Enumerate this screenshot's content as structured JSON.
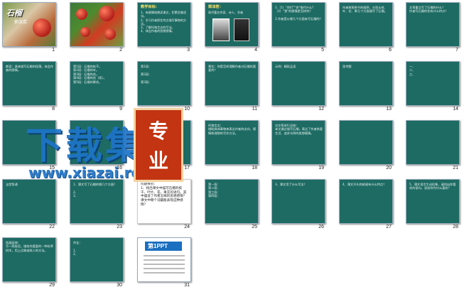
{
  "slides": [
    {
      "n": "1",
      "kind": "cover",
      "title": "石榴",
      "sub": "郭沫若"
    },
    {
      "n": "2",
      "kind": "photo"
    },
    {
      "n": "3",
      "title": "教学目标：",
      "body": "1、有感情地朗读课文，积累优美语句。\n2、学习作者抓住特点描写事物的方法。\n3、了解托物言志的写法。\n4、体会作者的思想感情。"
    },
    {
      "n": "4",
      "kind": "portrait",
      "title": "郭沫若：",
      "body": "现代著名作家、诗人、学者"
    },
    {
      "n": "5",
      "title": "",
      "body": "1.（1）\"你们\"\"你\"指代什么?\n（2）\"我\"的感情是怎样的？\n\n2.作者是从哪几个方面来写石榴的？"
    },
    {
      "n": "6",
      "title": "",
      "body": "作者按照季节的顺序，分别从枝、叶、花、果几个方面描写了石榴。"
    },
    {
      "n": "7",
      "title": "",
      "body": "文章重点写了石榴的什么？\n作者写石榴的花有什么特点？"
    },
    {
      "n": "8",
      "title": "",
      "body": "朗读：具体描写石榴的段落，体会作者的感情。"
    },
    {
      "n": "9",
      "title": "",
      "body": "第1段：石榴的枝干。\n第2段：石榴的叶。\n第3段：石榴的花。\n第4段：石榴的花（续）。\n第5段：石榴的果实。"
    },
    {
      "n": "10",
      "title": "",
      "body": "第1段：\n\n第2段：\n\n第3段："
    },
    {
      "n": "11",
      "title": "",
      "body": "果实：你是怎样理解作者对石榴的喜爱的？"
    },
    {
      "n": "12",
      "title": "",
      "body": "示例：精彩品读\n\n"
    },
    {
      "n": "13",
      "title": "",
      "body": "思考题\n\n"
    },
    {
      "n": "14",
      "title": "",
      "body": "一、\n二、\n三、"
    },
    {
      "n": "15",
      "title": "",
      "body": ""
    },
    {
      "n": "16",
      "title": "",
      "body": ""
    },
    {
      "n": "17",
      "title": "",
      "body": "作者对石榴的感情："
    },
    {
      "n": "18",
      "title": "",
      "body": "托物言志：\n借助具体事物来表达作者的志向、感情和理想的写作方法。"
    },
    {
      "n": "19",
      "title": "",
      "body": "对文章进行总结：\n本文通过描写石榴，表达了作者热爱生活、追求光明的思想感情。"
    },
    {
      "n": "20",
      "title": "",
      "body": ""
    },
    {
      "n": "21",
      "title": "",
      "body": ""
    },
    {
      "n": "22",
      "title": "",
      "body": "当堂背诵\n\n"
    },
    {
      "n": "23",
      "title": "",
      "body": "1、课文写了石榴的哪几个方面？\n\n2、\n3、"
    },
    {
      "n": "24",
      "kind": "plain",
      "title": "",
      "body": "问题探究：\n1、找出课文中描写石榴的枝干、叶片、花、果实的语句。其中蕴含了作者怎样的思想感情？课文中哪个词最能表现这种感情？"
    },
    {
      "n": "25",
      "title": "",
      "body": "第一段：\n第二段：\n第三段：\n第四段："
    },
    {
      "n": "26",
      "title": "",
      "body": "3、课文用了什么写法？"
    },
    {
      "n": "27",
      "title": "",
      "body": "4、课文开头和结尾有什么特点？"
    },
    {
      "n": "28",
      "title": "",
      "body": "5、课文语言生动形象，请找出你喜欢的语句，说说你为什么喜欢？"
    },
    {
      "n": "29",
      "title": "",
      "body": "拓展延伸：\n写一两段话，描绘你喜爱的一种花草树木，用上比喻或拟人的方法。"
    },
    {
      "n": "30",
      "title": "",
      "body": "作业：\n\n1、\n2、"
    },
    {
      "n": "31",
      "kind": "logo",
      "title": "第1PPT"
    }
  ],
  "watermark": {
    "text": "下载集",
    "url": "www.xiazai.red",
    "badge": "专业"
  }
}
